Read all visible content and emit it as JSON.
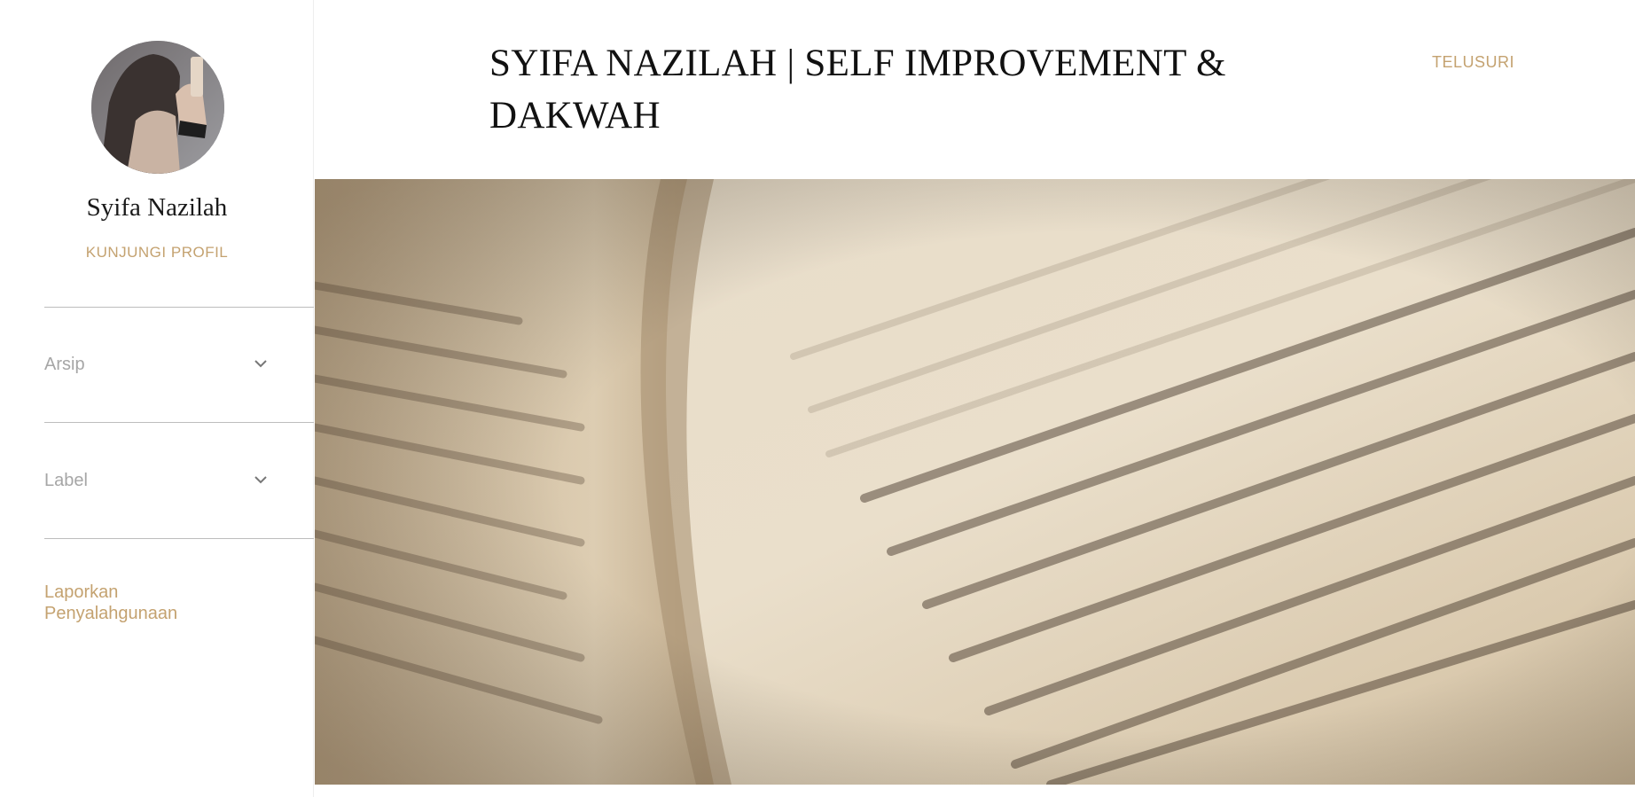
{
  "profile": {
    "name": "Syifa Nazilah",
    "visit_label": "KUNJUNGI PROFIL"
  },
  "sidebar": {
    "widgets": [
      {
        "label": "Arsip",
        "icon": "chevron-down-icon"
      },
      {
        "label": "Label",
        "icon": "chevron-down-icon"
      }
    ],
    "report_label": "Laporkan Penyalahgunaan"
  },
  "header": {
    "title": "SYIFA NAZILAH | SELF IMPROVEMENT & DAKWAH",
    "explore_label": "TELUSURI"
  },
  "theme": {
    "accent": "#c4a270",
    "muted": "#a6a6a6",
    "title_color": "#111111"
  }
}
